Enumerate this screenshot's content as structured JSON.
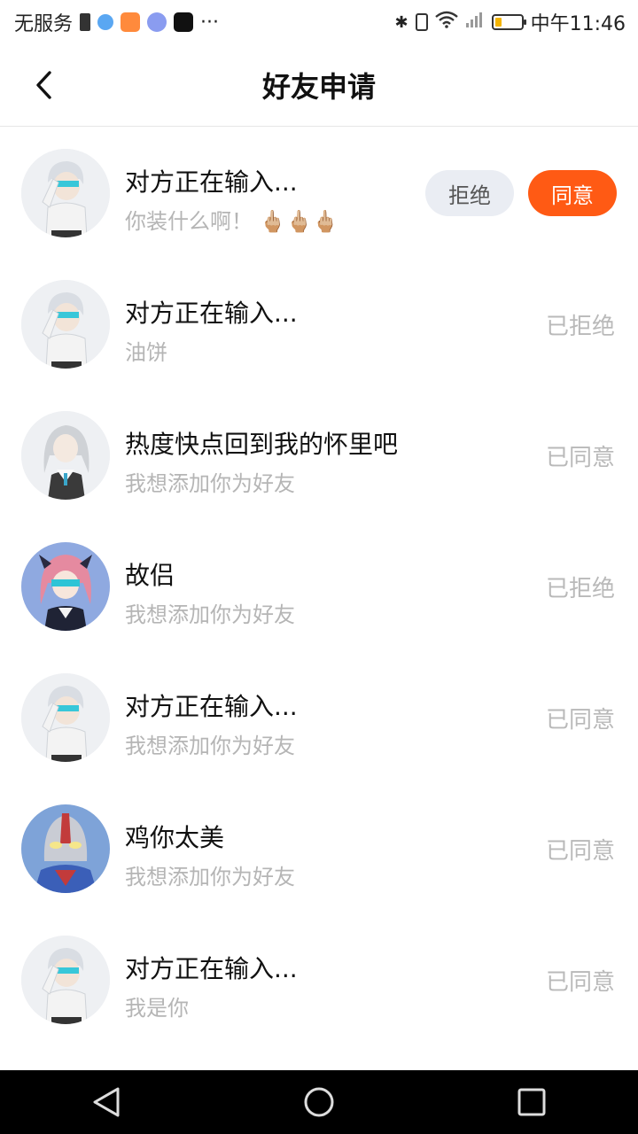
{
  "status_bar": {
    "carrier": "无服务",
    "more": "···",
    "time": "中午11:46",
    "battery_level": 0.25
  },
  "header": {
    "title": "好友申请"
  },
  "requests": [
    {
      "name": "对方正在输入...",
      "message": "你装什么啊！ 🖕🏼🖕🏼🖕🏼",
      "status": "",
      "reject_label": "拒绝",
      "accept_label": "同意",
      "avatar": "white-hair-boy"
    },
    {
      "name": "对方正在输入...",
      "message": "油饼",
      "status": "已拒绝",
      "avatar": "white-hair-boy"
    },
    {
      "name": "热度快点回到我的怀里吧",
      "message": "我想添加你为好友",
      "status": "已同意",
      "avatar": "grey-hair-girl"
    },
    {
      "name": "故侣",
      "message": "我想添加你为好友",
      "status": "已拒绝",
      "avatar": "pink-hair-girl"
    },
    {
      "name": "对方正在输入...",
      "message": "我想添加你为好友",
      "status": "已同意",
      "avatar": "white-hair-boy"
    },
    {
      "name": "鸡你太美",
      "message": "我想添加你为好友",
      "status": "已同意",
      "avatar": "ultraman"
    },
    {
      "name": "对方正在输入...",
      "message": "我是你",
      "status": "已同意",
      "avatar": "white-hair-boy"
    }
  ],
  "colors": {
    "accent": "#ff5a14",
    "reject_bg": "#eaedf3",
    "muted_text": "#b5b5b5"
  }
}
